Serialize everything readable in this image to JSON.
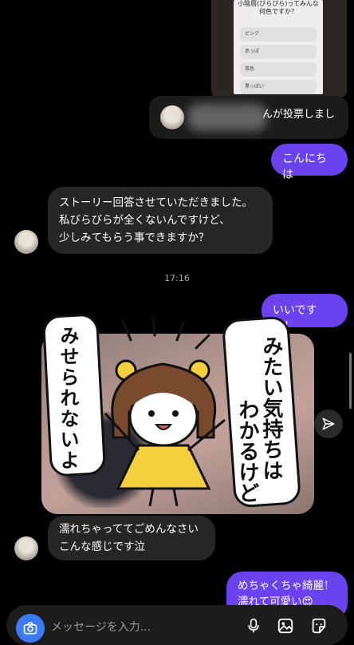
{
  "story_reply": {
    "question": "小陰唇(びらびら)ってみんな何色ですか？",
    "options": [
      "ピンク",
      "赤っぽ",
      "茶色",
      "黒っぽい"
    ],
    "voted_suffix": "んが投票しまし"
  },
  "messages": [
    {
      "from": "me",
      "text": "こんにちは"
    },
    {
      "from": "them",
      "lines": [
        "ストーリー回答させていただきました。",
        "私びらびらが全くないんですけど、",
        "少しみてもらう事できますか？"
      ]
    },
    {
      "from": "me",
      "text": "いいですよ！"
    },
    {
      "from": "them",
      "lines": [
        "濡れちゃっててごめんなさい",
        "こんな感じです泣"
      ]
    },
    {
      "from": "me",
      "lines": [
        "めちゃくちゃ綺麗！",
        "濡れて可愛い😍"
      ]
    }
  ],
  "timestamp": "17:16",
  "sticker": {
    "left_text": "みせられないよ",
    "right_text_1": "みたい気持ちは",
    "right_text_2": "わかるけど"
  },
  "composer": {
    "placeholder": "メッセージを入力..."
  },
  "colors": {
    "accent": "#6a43ee",
    "camera": "#3d7bf6",
    "incoming": "#262626"
  }
}
